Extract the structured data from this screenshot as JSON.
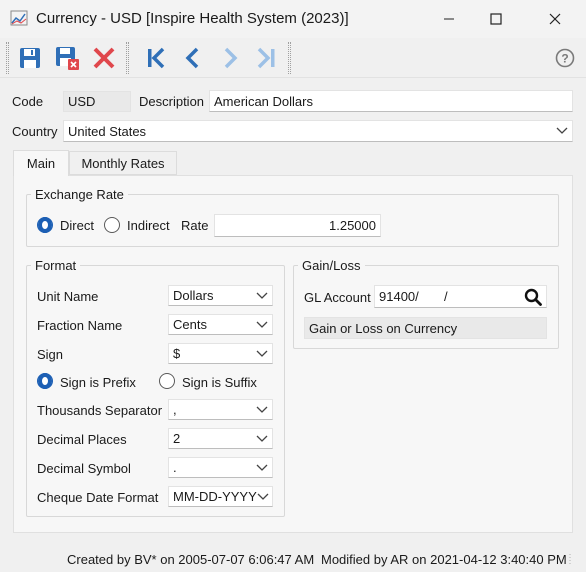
{
  "window": {
    "title": "Currency - USD [Inspire Health System (2023)]"
  },
  "toolbar": {
    "buttons": [
      {
        "name": "save",
        "icon": "save-icon"
      },
      {
        "name": "save-and-close",
        "icon": "save-close-icon"
      },
      {
        "name": "delete",
        "icon": "delete-icon"
      },
      {
        "name": "first",
        "icon": "first-record-icon"
      },
      {
        "name": "previous",
        "icon": "previous-record-icon"
      },
      {
        "name": "next",
        "icon": "next-record-icon"
      },
      {
        "name": "last",
        "icon": "last-record-icon"
      },
      {
        "name": "help",
        "icon": "help-icon"
      }
    ]
  },
  "header": {
    "code_label": "Code",
    "code_value": "USD",
    "description_label": "Description",
    "description_value": "American Dollars",
    "country_label": "Country",
    "country_value": "United States"
  },
  "tabs": [
    {
      "label": "Main",
      "active": true
    },
    {
      "label": "Monthly Rates",
      "active": false
    }
  ],
  "exchange_rate": {
    "title": "Exchange Rate",
    "direct_label": "Direct",
    "indirect_label": "Indirect",
    "selected": "Direct",
    "rate_label": "Rate",
    "rate_value": "1.25000"
  },
  "format": {
    "title": "Format",
    "unit_name_label": "Unit Name",
    "unit_name_value": "Dollars",
    "fraction_name_label": "Fraction Name",
    "fraction_name_value": "Cents",
    "sign_label": "Sign",
    "sign_value": "$",
    "sign_prefix_label": "Sign is Prefix",
    "sign_suffix_label": "Sign is Suffix",
    "sign_position_selected": "Sign is Prefix",
    "thousands_separator_label": "Thousands Separator",
    "thousands_separator_value": ",",
    "decimal_places_label": "Decimal Places",
    "decimal_places_value": "2",
    "decimal_symbol_label": "Decimal Symbol",
    "decimal_symbol_value": ".",
    "cheque_date_format_label": "Cheque Date Format",
    "cheque_date_format_value": "MM-DD-YYYY"
  },
  "gain_loss": {
    "title": "Gain/Loss",
    "gl_account_label": "GL Account",
    "gl_account_value": "91400/       /",
    "gl_account_description": "Gain or Loss on Currency"
  },
  "status": {
    "created": "Created by BV* on 2005-07-07 6:06:47 AM",
    "modified": "Modified by AR on 2021-04-12 3:40:40 PM"
  },
  "colors": {
    "accent": "#1c5fb4",
    "toolbar_blue": "#2f6fb7",
    "delete_red": "#e0474c"
  }
}
